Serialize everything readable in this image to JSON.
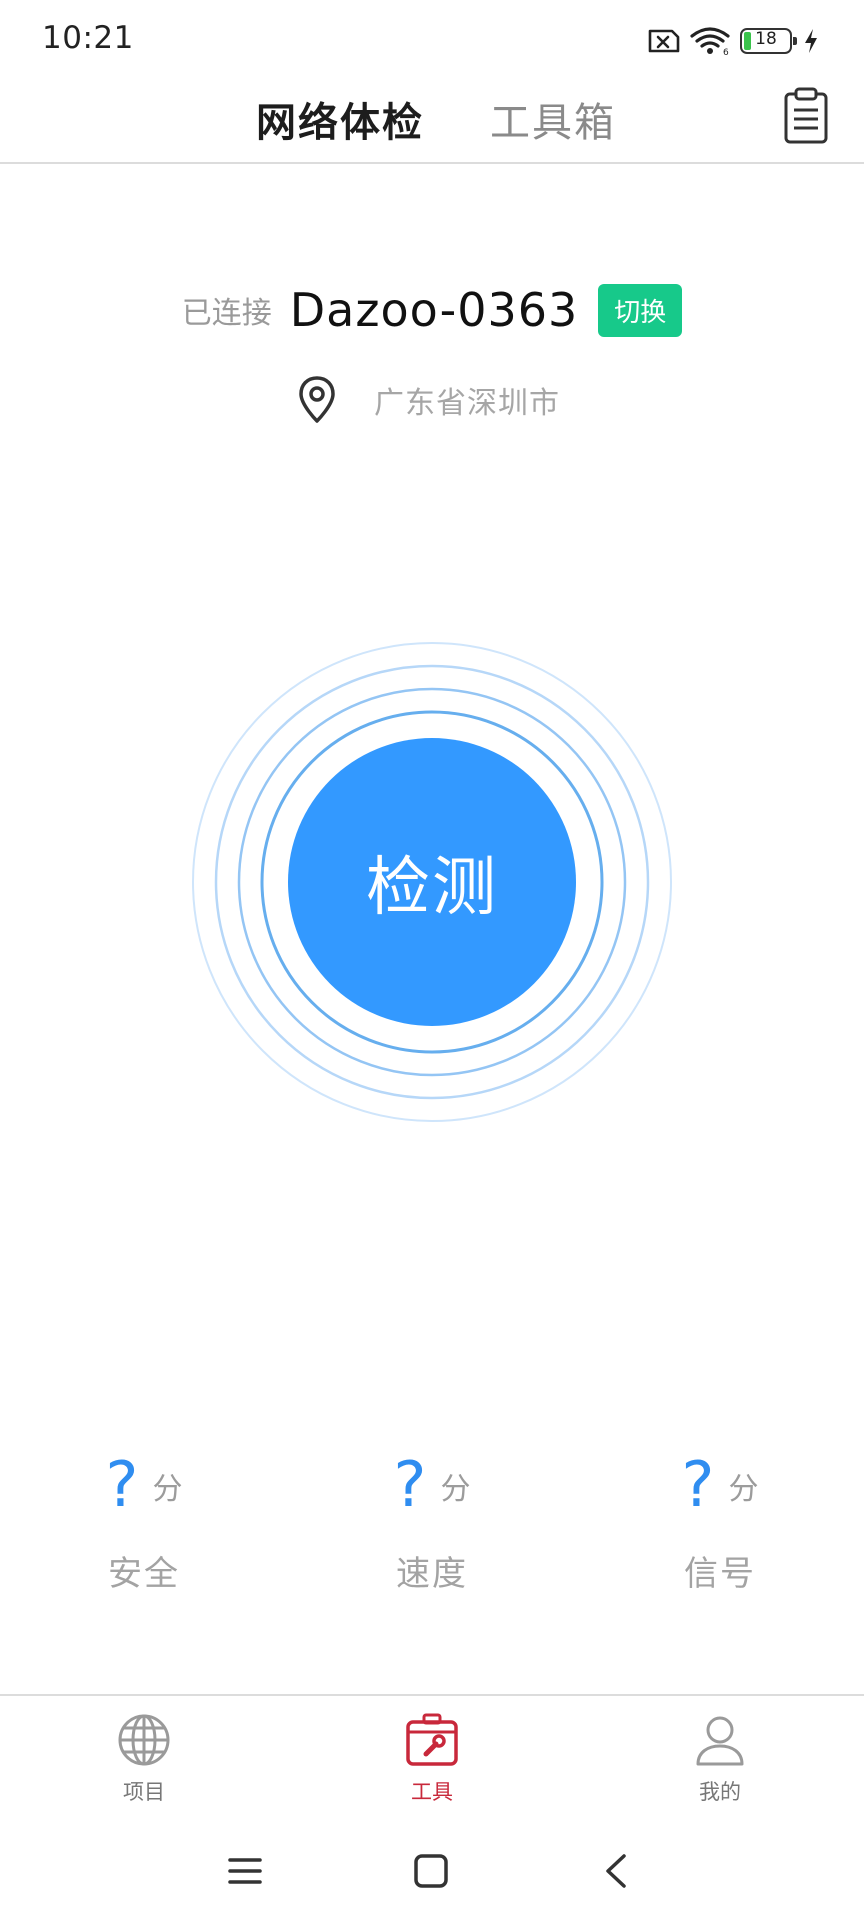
{
  "status_bar": {
    "time": "10:21",
    "battery_level": "18",
    "icons": [
      "sim-off-icon",
      "wifi-icon",
      "battery-icon",
      "charging-icon"
    ]
  },
  "header": {
    "tabs": [
      {
        "label": "网络体检",
        "active": true
      },
      {
        "label": "工具箱",
        "active": false
      }
    ],
    "right_icon": "clipboard-icon"
  },
  "connection": {
    "status_label": "已连接",
    "ssid": "Dazoo-0363",
    "switch_label": "切换",
    "location": "广东省深圳市"
  },
  "detect": {
    "label": "检测"
  },
  "scores": [
    {
      "value": "?",
      "unit": "分",
      "name": "安全"
    },
    {
      "value": "?",
      "unit": "分",
      "name": "速度"
    },
    {
      "value": "?",
      "unit": "分",
      "name": "信号"
    }
  ],
  "bottom_nav": {
    "items": [
      {
        "label": "项目",
        "icon": "globe-icon",
        "active": false
      },
      {
        "label": "工具",
        "icon": "toolbox-icon",
        "active": true
      },
      {
        "label": "我的",
        "icon": "user-icon",
        "active": false
      }
    ]
  },
  "colors": {
    "primary_blue": "#3399ff",
    "switch_green": "#17c98a",
    "active_red": "#c8283b",
    "score_blue": "#2f8df0"
  }
}
